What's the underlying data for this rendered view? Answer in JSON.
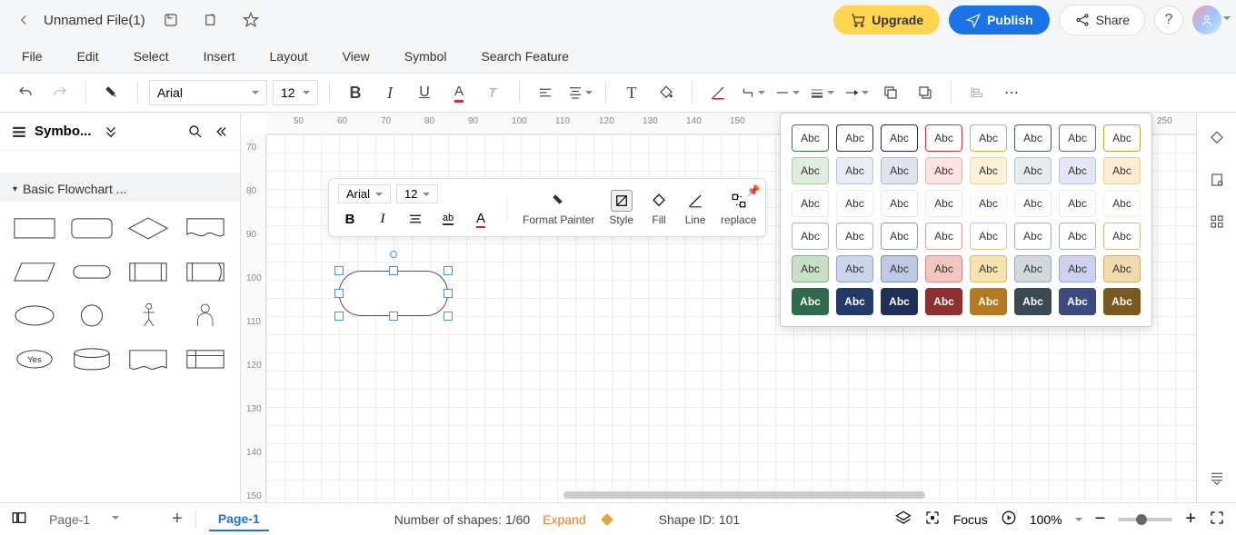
{
  "titlebar": {
    "filename": "Unnamed File(1)",
    "upgrade_label": "Upgrade",
    "publish_label": "Publish",
    "share_label": "Share"
  },
  "menubar": {
    "items": [
      "File",
      "Edit",
      "Select",
      "Insert",
      "Layout",
      "View",
      "Symbol",
      "Search Feature"
    ]
  },
  "toolbar": {
    "font": "Arial",
    "font_size": "12"
  },
  "left_panel": {
    "title": "Symbo...",
    "section_title": "Basic Flowchart ...",
    "yes_shape_label": "Yes"
  },
  "float_toolbar": {
    "font": "Arial",
    "font_size": "12",
    "format_painter": "Format Painter",
    "style": "Style",
    "fill": "Fill",
    "line": "Line",
    "replace": "replace"
  },
  "ruler_h_ticks": [
    "50",
    "60",
    "70",
    "80",
    "90",
    "100",
    "110",
    "120",
    "130",
    "140",
    "150",
    "250"
  ],
  "ruler_v_ticks": [
    "70",
    "80",
    "90",
    "100",
    "110",
    "120",
    "130",
    "140",
    "150"
  ],
  "style_popup": {
    "swatch_label": "Abc",
    "rows": [
      [
        {
          "bg": "#ffffff",
          "border": "#2e7d32",
          "color": "#333"
        },
        {
          "bg": "#ffffff",
          "border": "#333333",
          "color": "#333"
        },
        {
          "bg": "#ffffff",
          "border": "#1a237e",
          "color": "#333"
        },
        {
          "bg": "#ffffff",
          "border": "#d32f2f",
          "color": "#333"
        },
        {
          "bg": "#ffffff",
          "border": "#f9a825",
          "color": "#333"
        },
        {
          "bg": "#ffffff",
          "border": "#455a64",
          "color": "#333"
        },
        {
          "bg": "#ffffff",
          "border": "#5c6bc0",
          "color": "#333"
        },
        {
          "bg": "#ffffff",
          "border": "#c6a13a",
          "color": "#333"
        }
      ],
      [
        {
          "bg": "#dfeede",
          "border": "#a5cda1",
          "color": "#333"
        },
        {
          "bg": "#e8ecf5",
          "border": "#b9c4dc",
          "color": "#333"
        },
        {
          "bg": "#dfe4f0",
          "border": "#a6b2d6",
          "color": "#333"
        },
        {
          "bg": "#fbe3e1",
          "border": "#e8b4b0",
          "color": "#333"
        },
        {
          "bg": "#fdf1d6",
          "border": "#eed89a",
          "color": "#333"
        },
        {
          "bg": "#e6ecef",
          "border": "#b9c6cd",
          "color": "#333"
        },
        {
          "bg": "#e4e7f6",
          "border": "#bcc2e6",
          "color": "#333"
        },
        {
          "bg": "#fbecd3",
          "border": "#e9cf99",
          "color": "#333"
        }
      ],
      [
        {
          "bg": "#ffffff",
          "border": "#dfeede",
          "color": "#333"
        },
        {
          "bg": "#ffffff",
          "border": "#e8ecf5",
          "color": "#333"
        },
        {
          "bg": "#ffffff",
          "border": "#dfe4f0",
          "color": "#333"
        },
        {
          "bg": "#ffffff",
          "border": "#fbe3e1",
          "color": "#333"
        },
        {
          "bg": "#ffffff",
          "border": "#fdf1d6",
          "color": "#333"
        },
        {
          "bg": "#ffffff",
          "border": "#e6ecef",
          "color": "#333"
        },
        {
          "bg": "#ffffff",
          "border": "#e4e7f6",
          "color": "#333"
        },
        {
          "bg": "#ffffff",
          "border": "#fbecd3",
          "color": "#333"
        }
      ],
      [
        {
          "bg": "#ffffff",
          "border": "#9fbf9c",
          "color": "#333"
        },
        {
          "bg": "#ffffff",
          "border": "#a7b2c8",
          "color": "#333"
        },
        {
          "bg": "#ffffff",
          "border": "#8c9bc4",
          "color": "#333"
        },
        {
          "bg": "#ffffff",
          "border": "#da9f9a",
          "color": "#333"
        },
        {
          "bg": "#ffffff",
          "border": "#dfc885",
          "color": "#333"
        },
        {
          "bg": "#ffffff",
          "border": "#a2b1b9",
          "color": "#333"
        },
        {
          "bg": "#ffffff",
          "border": "#a3acd7",
          "color": "#333"
        },
        {
          "bg": "#ffffff",
          "border": "#d7ba82",
          "color": "#333"
        }
      ],
      [
        {
          "bg": "#c9e0c7",
          "border": "#86b181",
          "color": "#333"
        },
        {
          "bg": "#ccd6eb",
          "border": "#93a3c9",
          "color": "#333"
        },
        {
          "bg": "#bec9e6",
          "border": "#7b8cbf",
          "color": "#333"
        },
        {
          "bg": "#f2c6c1",
          "border": "#d88c85",
          "color": "#333"
        },
        {
          "bg": "#f7e3ad",
          "border": "#d8bf73",
          "color": "#333"
        },
        {
          "bg": "#cfd9de",
          "border": "#98a9b2",
          "color": "#333"
        },
        {
          "bg": "#ccd2ef",
          "border": "#9aa5d9",
          "color": "#333"
        },
        {
          "bg": "#f2dab0",
          "border": "#cfaf72",
          "color": "#333"
        }
      ],
      [
        {
          "bg": "#2f6a4f",
          "border": "#2f6a4f",
          "color": "#fff"
        },
        {
          "bg": "#223a6a",
          "border": "#223a6a",
          "color": "#fff"
        },
        {
          "bg": "#1f2e5a",
          "border": "#1f2e5a",
          "color": "#fff"
        },
        {
          "bg": "#8f2f2f",
          "border": "#8f2f2f",
          "color": "#fff"
        },
        {
          "bg": "#b37a1f",
          "border": "#b37a1f",
          "color": "#fff"
        },
        {
          "bg": "#3a4a52",
          "border": "#3a4a52",
          "color": "#fff"
        },
        {
          "bg": "#3c4a82",
          "border": "#3c4a82",
          "color": "#fff"
        },
        {
          "bg": "#7a5a1e",
          "border": "#7a5a1e",
          "color": "#fff"
        }
      ]
    ]
  },
  "statusbar": {
    "page_label_outline": "Page-1",
    "page_label_active": "Page-1",
    "shape_count": "Number of shapes: 1/60",
    "expand": "Expand",
    "shape_id": "Shape ID: 101",
    "focus": "Focus",
    "zoom": "100%"
  }
}
